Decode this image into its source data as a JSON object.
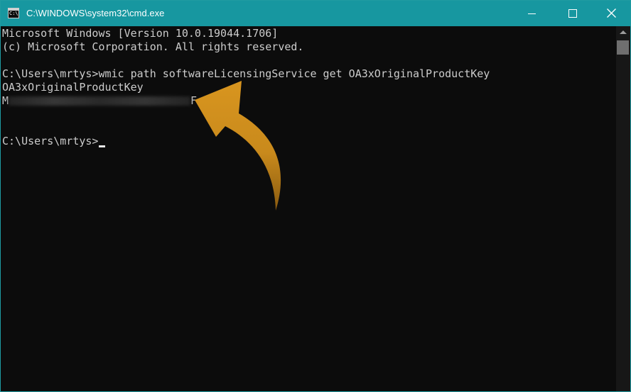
{
  "window": {
    "title": "C:\\WINDOWS\\system32\\cmd.exe",
    "app_icon_text": "C:\\",
    "minimize_glyph": "",
    "close_glyph": "✕"
  },
  "console": {
    "lines": [
      "Microsoft Windows [Version 10.0.19044.1706]",
      "(c) Microsoft Corporation. All rights reserved.",
      "",
      "C:\\Users\\mrtys>wmic path softwareLicensingService get OA3xOriginalProductKey",
      "OA3xOriginalProductKey"
    ],
    "product_key_first": "M",
    "product_key_last": "F",
    "prompt": "C:\\Users\\mrtys>"
  },
  "annotation": {
    "arrow_color": "#d18e1f",
    "arrow_icon": "curved-arrow-icon"
  },
  "colors": {
    "titlebar": "#1797a0",
    "console_bg": "#0c0c0c",
    "console_text": "#cccccc"
  }
}
